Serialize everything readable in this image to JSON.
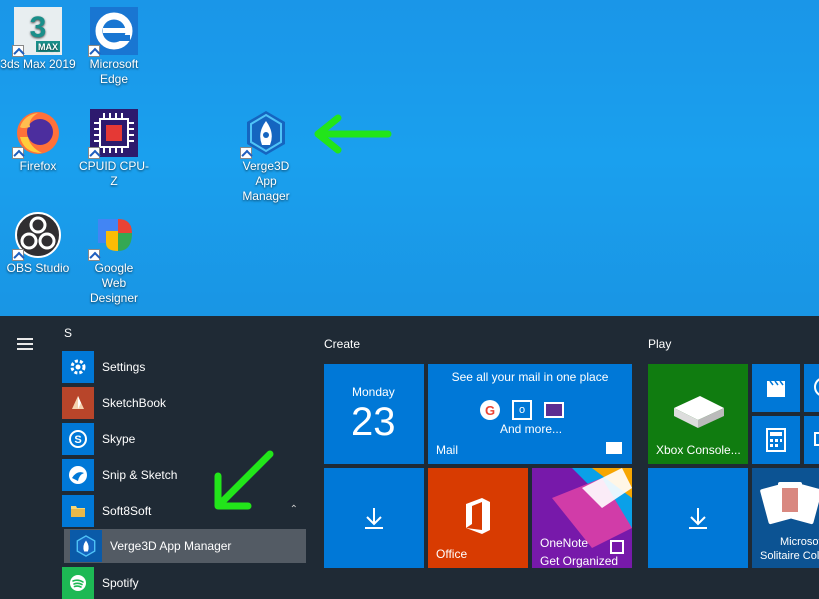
{
  "desktop": {
    "icons": [
      {
        "label": "3ds Max 2019"
      },
      {
        "label": "Microsoft Edge"
      },
      {
        "label": "Firefox"
      },
      {
        "label": "CPUID CPU-Z"
      },
      {
        "label": "Verge3D App Manager"
      },
      {
        "label": "OBS Studio"
      },
      {
        "label": "Google Web Designer"
      }
    ],
    "max_badge": "MAX",
    "max_digit": "3"
  },
  "start_menu": {
    "section_letter": "S",
    "apps": [
      {
        "label": "Settings"
      },
      {
        "label": "SketchBook"
      },
      {
        "label": "Skype"
      },
      {
        "label": "Snip & Sketch"
      },
      {
        "label": "Soft8Soft"
      },
      {
        "label": "Verge3D App Manager"
      },
      {
        "label": "Spotify"
      }
    ],
    "groups": {
      "create": "Create",
      "play": "Play"
    },
    "tiles": {
      "calendar_day": "Monday",
      "calendar_date": "23",
      "mail_text": "See all your mail in one place",
      "mail_more": "And more...",
      "mail_label": "Mail",
      "office_label": "Office",
      "onenote_label": "OneNote",
      "onenote_sub": "Get Organized",
      "xbox_label": "Xbox Console...",
      "solitaire_label_1": "Microsof",
      "solitaire_label_2": "Solitaire Colle"
    }
  },
  "colors": {
    "desktop_blue": "#1a96e8",
    "start_bg": "#1f2a35",
    "tile_blue": "#0078d7",
    "office_orange": "#d83b01",
    "onenote_purple": "#7719aa",
    "xbox_green": "#107c10",
    "arrow_green": "#22e51a"
  }
}
